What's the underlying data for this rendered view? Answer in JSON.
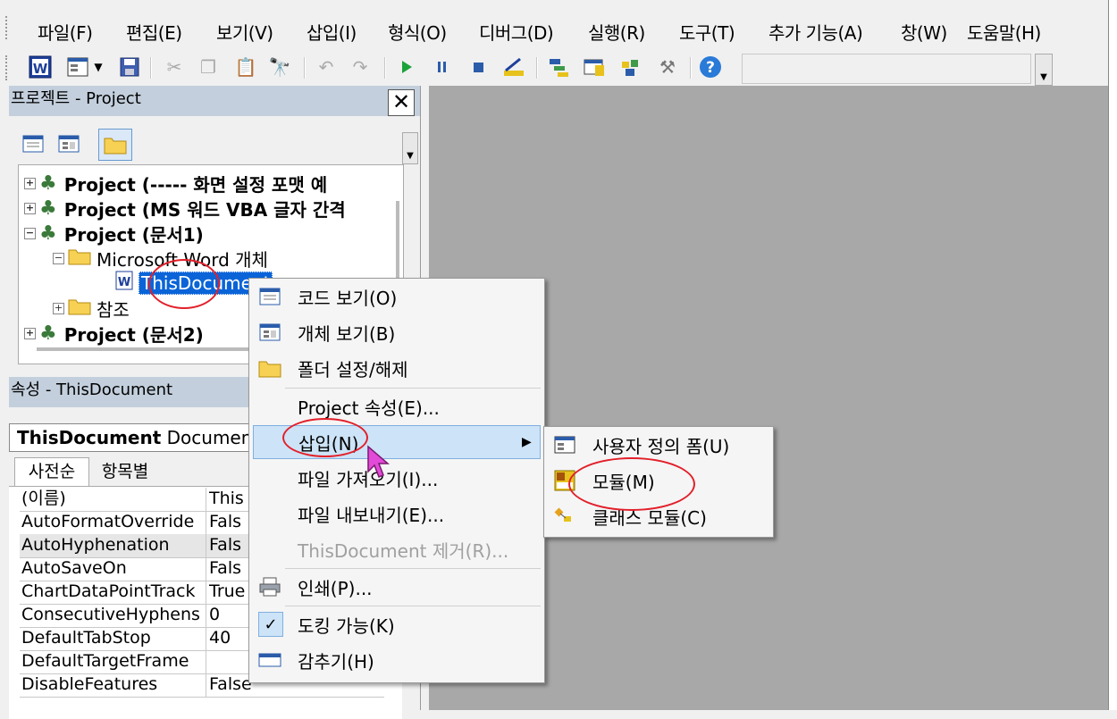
{
  "menubar": {
    "items": [
      "파일(F)",
      "편집(E)",
      "보기(V)",
      "삽입(I)",
      "형식(O)",
      "디버그(D)",
      "실행(R)",
      "도구(T)",
      "추가 기능(A)",
      "창(W)",
      "도움말(H)"
    ]
  },
  "project": {
    "title": "프로젝트 - Project",
    "tree": [
      "Project (----- 화면 설정 포맷 예",
      "Project (MS 워드 VBA 글자 간격",
      "Project (문서1)",
      "Microsoft Word 개체",
      "ThisDocument",
      "참조",
      "Project (문서2)"
    ]
  },
  "properties": {
    "title": "속성 - ThisDocument",
    "object_name": "ThisDocument",
    "object_type": "Document",
    "tabs": [
      "사전순",
      "항목별"
    ],
    "rows": [
      {
        "name": "(이름)",
        "value": "This"
      },
      {
        "name": "AutoFormatOverride",
        "value": "Fals"
      },
      {
        "name": "AutoHyphenation",
        "value": "Fals"
      },
      {
        "name": "AutoSaveOn",
        "value": "Fals"
      },
      {
        "name": "ChartDataPointTrack",
        "value": "True"
      },
      {
        "name": "ConsecutiveHyphens",
        "value": "0"
      },
      {
        "name": "DefaultTabStop",
        "value": "40"
      },
      {
        "name": "DefaultTargetFrame",
        "value": ""
      },
      {
        "name": "DisableFeatures",
        "value": "False"
      }
    ]
  },
  "context_menu": {
    "items": [
      "코드 보기(O)",
      "개체 보기(B)",
      "폴더 설정/해제",
      "Project 속성(E)...",
      "삽입(N)",
      "파일 가져오기(I)...",
      "파일 내보내기(E)...",
      "ThisDocument 제거(R)...",
      "인쇄(P)...",
      "도킹 가능(K)",
      "감추기(H)"
    ]
  },
  "submenu": {
    "items": [
      "사용자 정의 폼(U)",
      "모듈(M)",
      "클래스 모듈(C)"
    ]
  },
  "colors": {
    "selection": "#0a64d8",
    "highlight": "#cde3f7",
    "annotation": "#e2202a",
    "code_area": "#a8a8a8"
  }
}
